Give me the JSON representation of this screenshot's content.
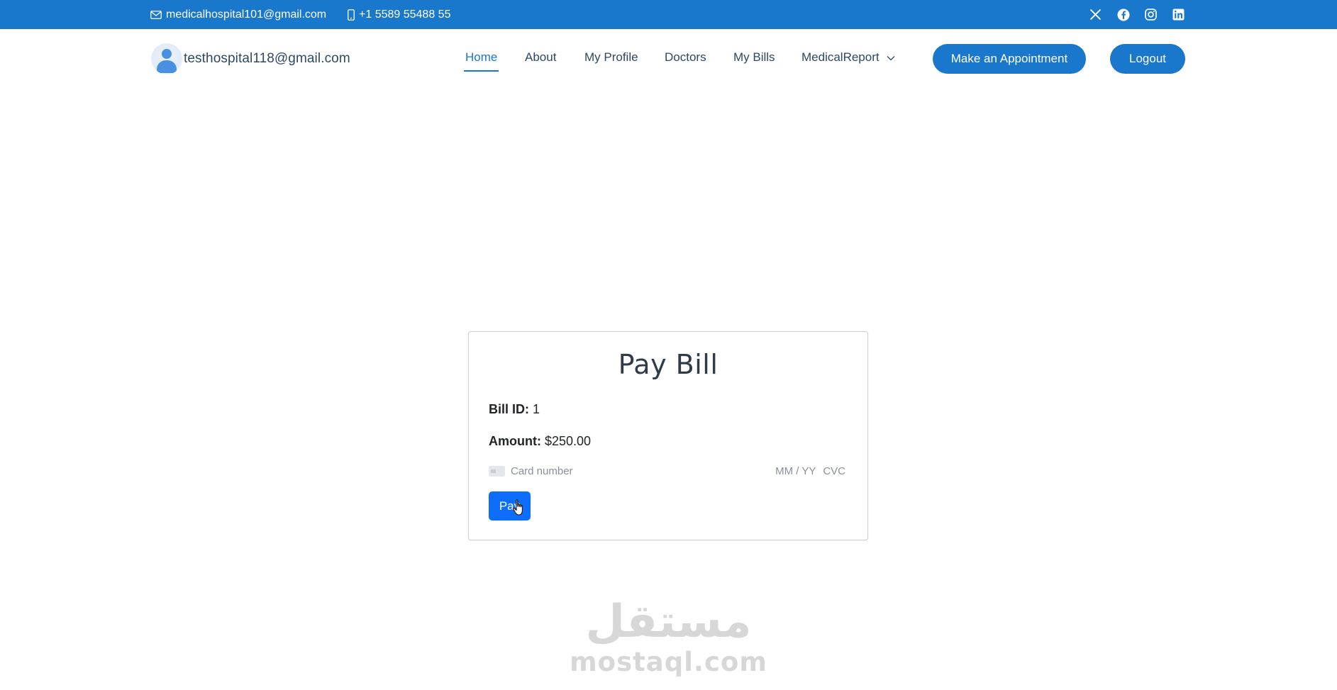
{
  "topbar": {
    "email": "medicalhospital101@gmail.com",
    "phone": "+1 5589 55488 55",
    "socials": [
      "x-twitter-icon",
      "facebook-icon",
      "instagram-icon",
      "linkedin-icon"
    ]
  },
  "header": {
    "user_email": "testhospital118@gmail.com",
    "nav": {
      "home": "Home",
      "about": "About",
      "profile": "My Profile",
      "doctors": "Doctors",
      "bills": "My Bills",
      "report": "MedicalReport"
    },
    "appointment_label": "Make an Appointment",
    "logout_label": "Logout"
  },
  "pay_bill": {
    "title": "Pay Bill",
    "bill_id_label": "Bill ID:",
    "bill_id_value": "1",
    "amount_label": "Amount:",
    "amount_value": "$250.00",
    "card_placeholder": "Card number",
    "expiry_placeholder": "MM / YY",
    "cvc_placeholder": "CVC",
    "pay_label": "Pay"
  },
  "watermark": {
    "arabic": "مستقل",
    "latin": "mostaql.com"
  },
  "colors": {
    "primary": "#1977cc",
    "pay_button": "#0d6efd",
    "text": "#2c4964"
  }
}
